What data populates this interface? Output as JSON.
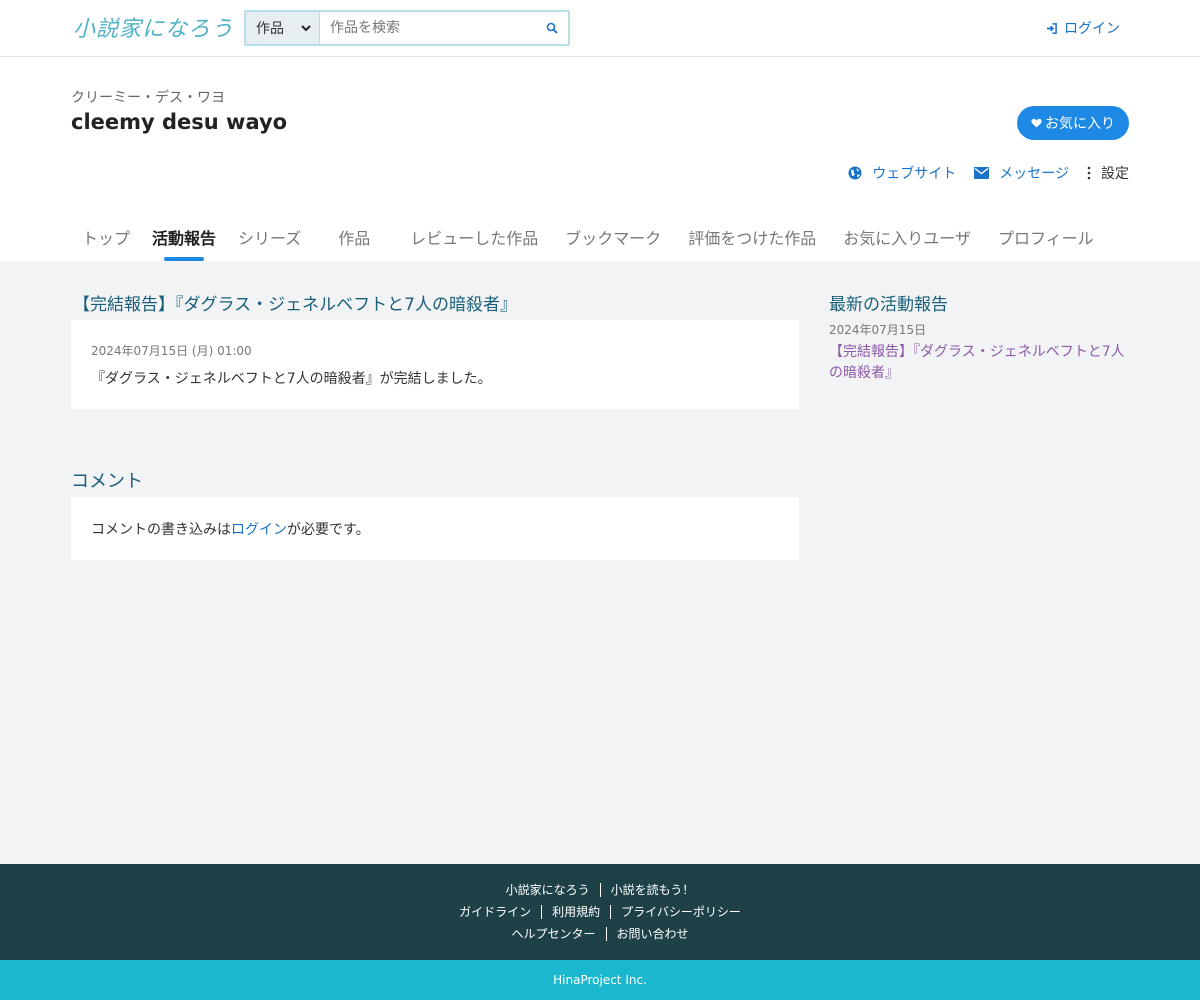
{
  "header": {
    "logo_text": "小説家になろう",
    "search": {
      "category": "作品",
      "placeholder": "作品を検索"
    },
    "login_label": "ログイン"
  },
  "profile": {
    "kana_name": "クリーミー・デス・ワヨ",
    "username": "cleemy desu wayo",
    "favorite_label": "お気に入り",
    "actions": {
      "website": "ウェブサイト",
      "message": "メッセージ",
      "settings": "設定"
    },
    "tabs": [
      {
        "label": "トップ"
      },
      {
        "label": "活動報告"
      },
      {
        "label": "シリーズ"
      },
      {
        "label": "作品"
      },
      {
        "label": "レビューした作品"
      },
      {
        "label": "ブックマーク"
      },
      {
        "label": "評価をつけた作品"
      },
      {
        "label": "お気に入りユーザ"
      },
      {
        "label": "プロフィール"
      }
    ],
    "active_tab": "活動報告"
  },
  "report": {
    "title": "【完結報告】『ダグラス・ジェネルベフトと7人の暗殺者』",
    "date": "2024年07月15日 (月) 01:00",
    "body": "『ダグラス・ジェネルベフトと7人の暗殺者』が完結しました。"
  },
  "comments": {
    "heading": "コメント",
    "prefix": "コメントの書き込みは",
    "login_link": "ログイン",
    "suffix": "が必要です。"
  },
  "sidebar": {
    "heading": "最新の活動報告",
    "date": "2024年07月15日",
    "link": "【完結報告】『ダグラス・ジェネルベフトと7人の暗殺者』"
  },
  "footer": {
    "row1": [
      "小説家になろう",
      "小説を読もう！"
    ],
    "row2": [
      "ガイドライン",
      "利用規約",
      "プライバシーポリシー"
    ],
    "row3": [
      "ヘルプセンター",
      "お問い合わせ"
    ],
    "copyright": "HinaProject Inc."
  },
  "colors": {
    "accent": "#1e88e5",
    "link": "#1a73c8",
    "heading": "#1a5f7a",
    "visited_link": "#8e5aa8",
    "footer_bg": "#1e4147",
    "copyright_bg": "#1ab8cf",
    "page_bg": "#f1f3f5"
  }
}
